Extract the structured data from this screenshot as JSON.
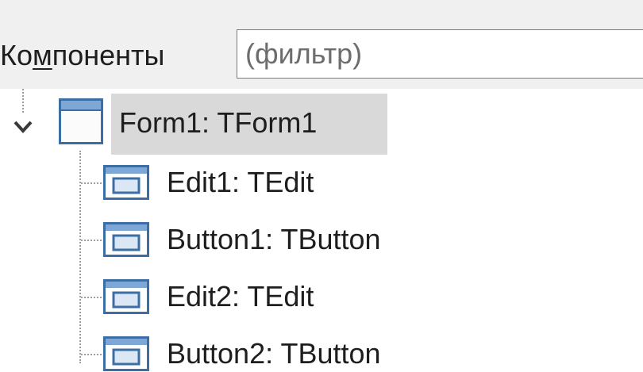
{
  "filter": {
    "label_before": "Ко",
    "label_accel": "м",
    "label_after": "поненты",
    "placeholder": "(фильтр)",
    "value": ""
  },
  "tree": {
    "root": {
      "label": "Form1: TForm1",
      "expanded": true,
      "selected": true,
      "icon": "form-icon"
    },
    "children": [
      {
        "label": "Edit1: TEdit",
        "icon": "component-icon"
      },
      {
        "label": "Button1: TButton",
        "icon": "component-icon"
      },
      {
        "label": "Edit2: TEdit",
        "icon": "component-icon"
      },
      {
        "label": "Button2: TButton",
        "icon": "component-icon"
      }
    ]
  },
  "colors": {
    "selection_bg": "#d9d9d9",
    "toolbar_bg": "#f0f0f0",
    "icon_blue": "#3b6ea5",
    "icon_titlebar": "#7fa7d6"
  }
}
